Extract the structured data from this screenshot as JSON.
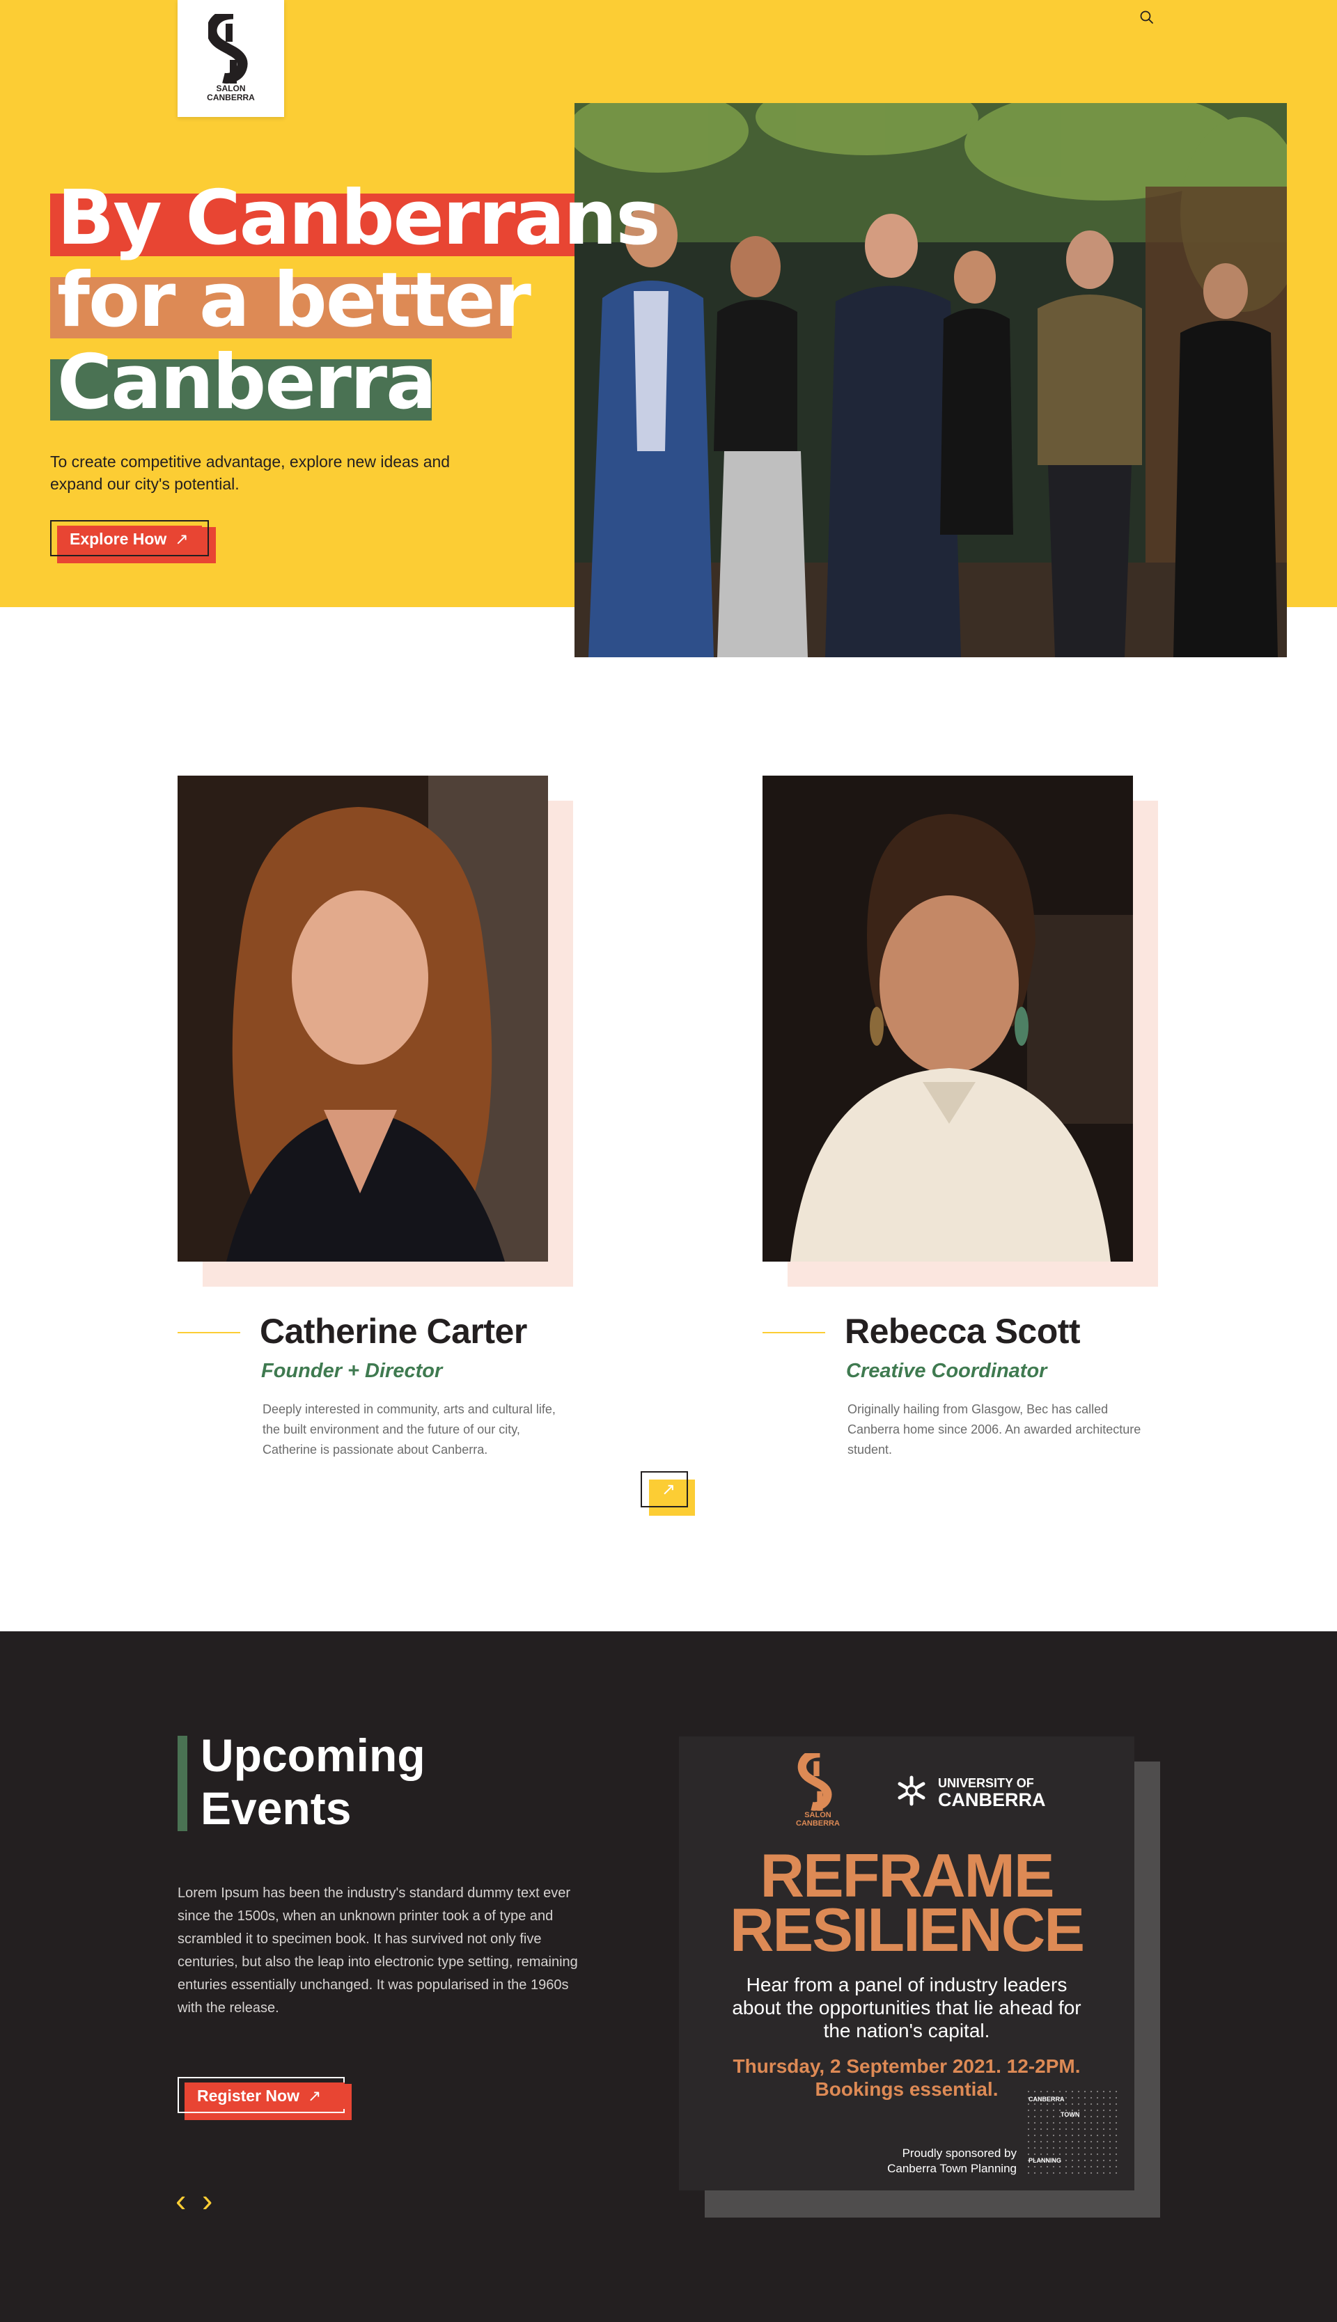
{
  "brand": {
    "logo_line1": "SALON",
    "logo_line2": "CANBERRA"
  },
  "hero": {
    "headline_line1": "By Canberrans",
    "headline_line2": "for a better",
    "headline_line3": "Canberra",
    "subtitle": "To create competitive advantage, explore new ideas and expand our city's potential.",
    "cta_label": "Explore How",
    "cta_arrow": "↗"
  },
  "team": [
    {
      "name": "Catherine Carter",
      "role": "Founder + Director",
      "bio": "Deeply interested in community, arts and cultural life, the built environment and the future of our city, Catherine is passionate about Canberra."
    },
    {
      "name": "Rebecca Scott",
      "role": "Creative Coordinator",
      "bio": "Originally hailing from Glasgow, Bec has called Canberra home since 2006. An awarded architecture student."
    }
  ],
  "team_next_glyph": "↗",
  "events": {
    "title": "Upcoming Events",
    "text": "Lorem Ipsum has been the industry's standard dummy text ever since the 1500s, when an unknown printer took a  of type and scrambled it to  specimen book. It has survived not only five centuries, but also the leap into electronic type setting, remaining enturies essentially unchanged. It was popularised in the 1960s with the release.",
    "cta_label": "Register Now",
    "cta_arrow": "↗",
    "prev_glyph": "‹",
    "next_glyph": "›"
  },
  "poster": {
    "logo_line1": "SALON",
    "logo_line2": "CANBERRA",
    "university_line1": "UNIVERSITY OF",
    "university_line2": "CANBERRA",
    "title_line1": "REFRAME",
    "title_line2": "RESILIENCE",
    "lead": "Hear from a panel of industry leaders about the opportunities that lie ahead for the nation's capital.",
    "date_line1": "Thursday, 2 September 2021. 12-2PM.",
    "date_line2": "Bookings essential.",
    "sponsor_line1": "Proudly sponsored by",
    "sponsor_line2": "Canberra Town Planning",
    "ctp_line1": "CANBERRA",
    "ctp_line2": "TOWN",
    "ctp_line3": "PLANNING"
  },
  "colors": {
    "yellow": "#fccd34",
    "red": "#e84533",
    "orange": "#dd8a55",
    "green": "#4a7253",
    "dark": "#231f20",
    "peach": "#fbe6df"
  },
  "icons": {
    "search": "search-icon",
    "arrow": "arrow-up-right-icon",
    "prev": "chevron-left-icon",
    "next": "chevron-right-icon"
  }
}
